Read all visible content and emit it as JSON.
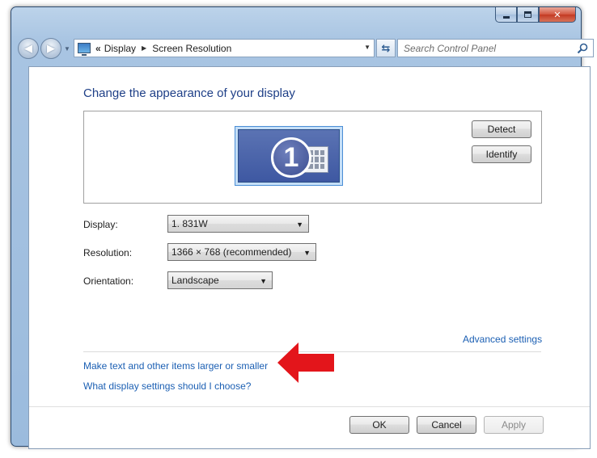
{
  "window": {
    "caption_buttons": {
      "minimize": "minimize-icon",
      "maximize": "maximize-icon",
      "close": "close-icon"
    }
  },
  "nav": {
    "back_icon": "back-arrow-icon",
    "forward_icon": "forward-arrow-icon",
    "address": {
      "overflow": "«",
      "crumbs": [
        "Display",
        "Screen Resolution"
      ]
    },
    "search_placeholder": "Search Control Panel"
  },
  "main": {
    "heading": "Change the appearance of your display",
    "monitor_number": "1",
    "detect_label": "Detect",
    "identify_label": "Identify",
    "display_label": "Display:",
    "display_value": "1. 831W",
    "resolution_label": "Resolution:",
    "resolution_value": "1366 × 768 (recommended)",
    "orientation_label": "Orientation:",
    "orientation_value": "Landscape",
    "advanced_link": "Advanced settings",
    "text_size_link": "Make text and other items larger or smaller",
    "help_link": "What display settings should I choose?"
  },
  "footer": {
    "ok_label": "OK",
    "cancel_label": "Cancel",
    "apply_label": "Apply"
  },
  "colors": {
    "link": "#1b5fb3",
    "heading": "#1e3f87",
    "annotation_arrow": "#e3151b"
  }
}
